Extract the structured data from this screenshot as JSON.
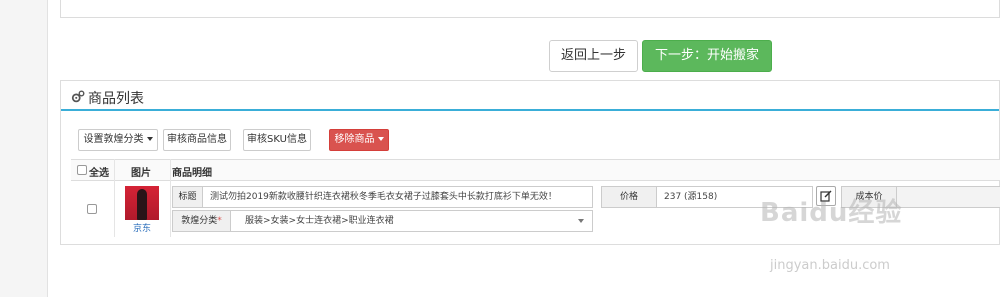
{
  "actions": {
    "back_label": "返回上一步",
    "next_label": "下一步：开始搬家"
  },
  "panel": {
    "title": "商品列表",
    "icon": "gears-icon"
  },
  "toolbar": {
    "set_category_label": "设置敦煌分类",
    "review_info_label": "审核商品信息",
    "review_sku_label": "审核SKU信息",
    "remove_label": "移除商品"
  },
  "table": {
    "headers": {
      "select_all": "全选",
      "image": "图片",
      "detail": "商品明细"
    },
    "rows": [
      {
        "store": "京东",
        "title_label": "标题",
        "title_value": "测试勿拍2019新款收腰针织连衣裙秋冬季毛衣女裙子过膝套头中长款打底衫下单无效！",
        "category_label": "敦煌分类",
        "category_required": "*",
        "category_value": "服装>女装>女士连衣裙>职业连衣裙",
        "price_label": "价格",
        "price_value": "237 (源158)",
        "cost_label": "成本价"
      }
    ]
  },
  "watermark": {
    "text": "Baidu经验",
    "sub": "jingyan.baidu.com"
  },
  "colors": {
    "primary_green": "#5cb85c",
    "danger_red": "#d9534f",
    "accent_blue": "#3aaed8"
  }
}
